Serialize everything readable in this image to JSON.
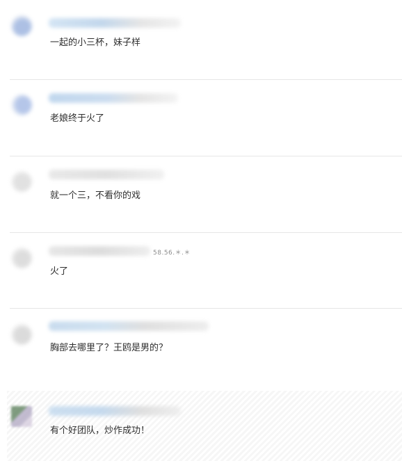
{
  "comments": [
    {
      "text": "一起的小三杯，妹子样",
      "ip": ""
    },
    {
      "text": "老娘终于火了",
      "ip": ""
    },
    {
      "text": "就一个三，不看你的戏",
      "ip": ""
    },
    {
      "text": "火了",
      "ip": "58.56.＊.＊"
    },
    {
      "text": "胸部去哪里了？王鸥是男的？",
      "ip": ""
    },
    {
      "text": "有个好团队，炒作成功！",
      "ip": ""
    }
  ],
  "colors": {
    "divider": "#e6e6e6",
    "highlight_bg": "#f4f4f4",
    "username_blur": "#c8dcef"
  }
}
